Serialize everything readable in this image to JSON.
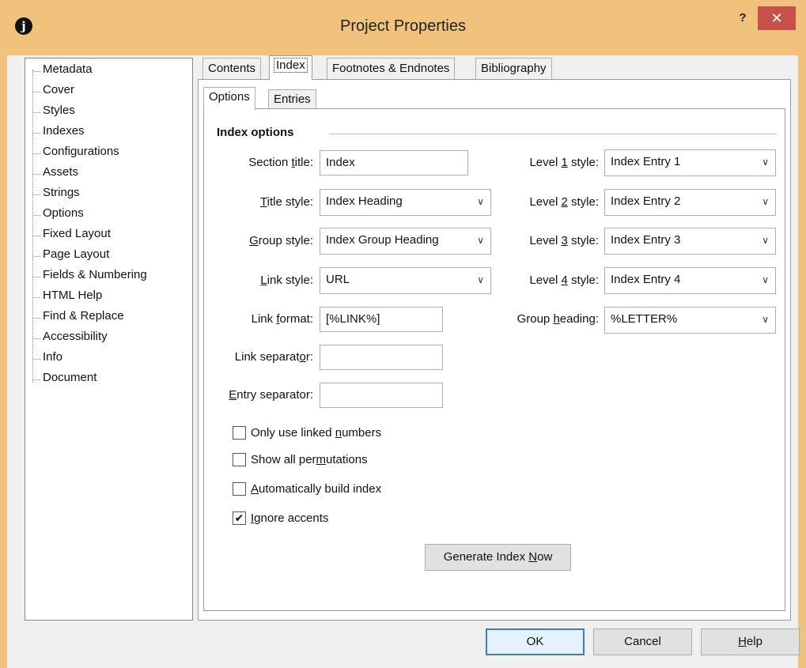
{
  "window": {
    "title": "Project Properties",
    "help_glyph": "?",
    "close_glyph": "✕",
    "app_icon": "j"
  },
  "sidebar": {
    "items": [
      {
        "label": "Metadata"
      },
      {
        "label": "Cover"
      },
      {
        "label": "Styles"
      },
      {
        "label": "Indexes",
        "selected": true
      },
      {
        "label": "Configurations"
      },
      {
        "label": "Assets"
      },
      {
        "label": "Strings"
      },
      {
        "label": "Options"
      },
      {
        "label": "Fixed Layout"
      },
      {
        "label": "Page Layout"
      },
      {
        "label": "Fields & Numbering"
      },
      {
        "label": "HTML Help"
      },
      {
        "label": "Find & Replace"
      },
      {
        "label": "Accessibility"
      },
      {
        "label": "Info"
      },
      {
        "label": "Document"
      }
    ]
  },
  "tabs": [
    {
      "label": "Contents"
    },
    {
      "label": "Index",
      "active": true
    },
    {
      "label": "Footnotes & Endnotes"
    },
    {
      "label": "Bibliography"
    }
  ],
  "subtabs": [
    {
      "label": "Options",
      "active": true
    },
    {
      "label": "Entries"
    }
  ],
  "index_options": {
    "group_title": "Index options",
    "section_title": {
      "pre": "Section ",
      "key": "t",
      "post": "itle:",
      "value": "Index"
    },
    "title_style": {
      "pre": "",
      "key": "T",
      "post": "itle style:",
      "value": "Index Heading"
    },
    "group_style": {
      "pre": "",
      "key": "G",
      "post": "roup style:",
      "value": "Index Group Heading"
    },
    "link_style": {
      "pre": "",
      "key": "L",
      "post": "ink style:",
      "value": "URL"
    },
    "link_format": {
      "pre": "Link ",
      "key": "f",
      "post": "ormat:",
      "value": "[%LINK%]"
    },
    "link_separator": {
      "pre": "Link separat",
      "key": "o",
      "post": "r:",
      "value": ""
    },
    "entry_separator": {
      "pre": "",
      "key": "E",
      "post": "ntry separator:",
      "value": ""
    },
    "level1_style": {
      "pre": "Level ",
      "key": "1",
      "post": " style:",
      "value": "Index Entry 1"
    },
    "level2_style": {
      "pre": "Level ",
      "key": "2",
      "post": " style:",
      "value": "Index Entry 2"
    },
    "level3_style": {
      "pre": "Level ",
      "key": "3",
      "post": " style:",
      "value": "Index Entry 3"
    },
    "level4_style": {
      "pre": "Level ",
      "key": "4",
      "post": " style:",
      "value": "Index Entry 4"
    },
    "group_heading": {
      "pre": "Group ",
      "key": "h",
      "post": "eading:",
      "value": "%LETTER%"
    },
    "checkboxes": [
      {
        "pre": "Only use linked ",
        "key": "n",
        "post": "umbers",
        "checked": false
      },
      {
        "pre": "Show all per",
        "key": "m",
        "post": "utations",
        "checked": false
      },
      {
        "pre": "",
        "key": "A",
        "post": "utomatically build index",
        "checked": false
      },
      {
        "pre": "",
        "key": "I",
        "post": "gnore accents",
        "checked": true
      }
    ],
    "generate_button": {
      "pre": "Generate Index ",
      "key": "N",
      "post": "ow"
    }
  },
  "footer": {
    "ok": "OK",
    "cancel": "Cancel",
    "help": {
      "pre": "",
      "key": "H",
      "post": "elp"
    }
  }
}
